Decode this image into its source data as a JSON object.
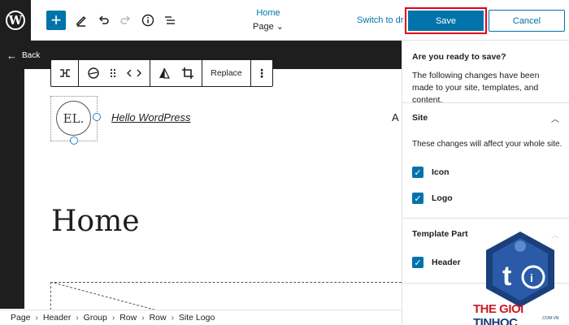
{
  "topbar": {
    "logo_letter": "W",
    "add_icon": "plus-icon",
    "doc_title": "Home",
    "doc_type": "Page ⌄",
    "draft_label": "Switch to draft",
    "save_label": "Save",
    "cancel_label": "Cancel"
  },
  "left": {
    "back_label": "Back",
    "block_toolbar": {
      "replace_label": "Replace"
    },
    "logo_text": "EL.",
    "site_title": "Hello WordPress",
    "nav_letter": "A",
    "page_heading": "Home"
  },
  "breadcrumbs": [
    "Page",
    "Header",
    "Group",
    "Row",
    "Row",
    "Site Logo"
  ],
  "panel": {
    "heading": "Are you ready to save?",
    "description": "The following changes have been made to your site, templates, and content.",
    "site_section": {
      "title": "Site",
      "description": "These changes will affect your whole site.",
      "items": [
        "Icon",
        "Logo"
      ]
    },
    "template_section": {
      "title": "Template Part",
      "items": [
        "Header"
      ]
    }
  },
  "watermark": {
    "part1": "THE GIOI",
    "part2": "TINHOC",
    "domain": ".COM.VN"
  },
  "colors": {
    "accent": "#0073aa",
    "highlight": "#e0001b",
    "dark": "#1e1e1e"
  }
}
